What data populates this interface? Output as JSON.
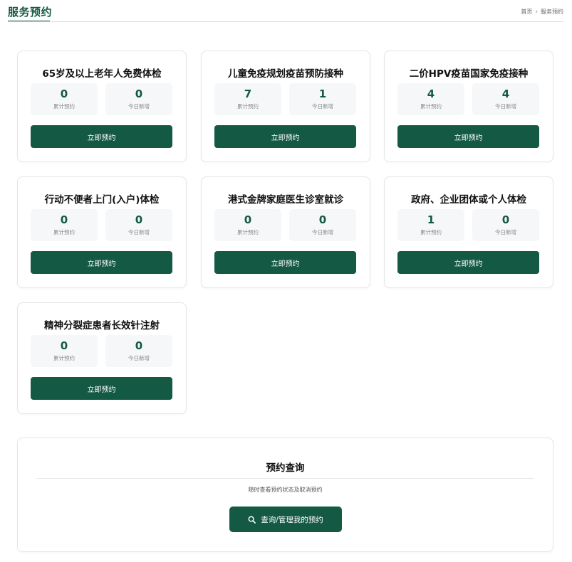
{
  "header": {
    "title": "服务预约",
    "breadcrumb": {
      "home": "首页",
      "separator": "›",
      "current": "服务预约"
    }
  },
  "stat_labels": {
    "total": "累计预约",
    "today": "今日新增"
  },
  "services": [
    {
      "title": "65岁及以上老年人免费体检",
      "total": "0",
      "today": "0",
      "button": "立即预约"
    },
    {
      "title": "儿童免疫规划疫苗预防接种",
      "total": "7",
      "today": "1",
      "button": "立即预约"
    },
    {
      "title": "二价HPV疫苗国家免疫接种",
      "total": "4",
      "today": "4",
      "button": "立即预约"
    },
    {
      "title": "行动不便者上门(入户)体检",
      "total": "0",
      "today": "0",
      "button": "立即预约"
    },
    {
      "title": "港式金牌家庭医生诊室就诊",
      "total": "0",
      "today": "0",
      "button": "立即预约"
    },
    {
      "title": "政府、企业团体或个人体检",
      "total": "1",
      "today": "0",
      "button": "立即预约"
    },
    {
      "title": "精神分裂症患者长效针注射",
      "total": "0",
      "today": "0",
      "button": "立即预约"
    }
  ],
  "query": {
    "title": "预约查询",
    "subtitle": "随时查看预约状态及取消预约",
    "button": "查询/管理我的预约",
    "icon": "search-icon"
  },
  "colors": {
    "brand": "#145943",
    "stat_bg": "#f6f7f9",
    "card_border": "#e3e6e8"
  }
}
